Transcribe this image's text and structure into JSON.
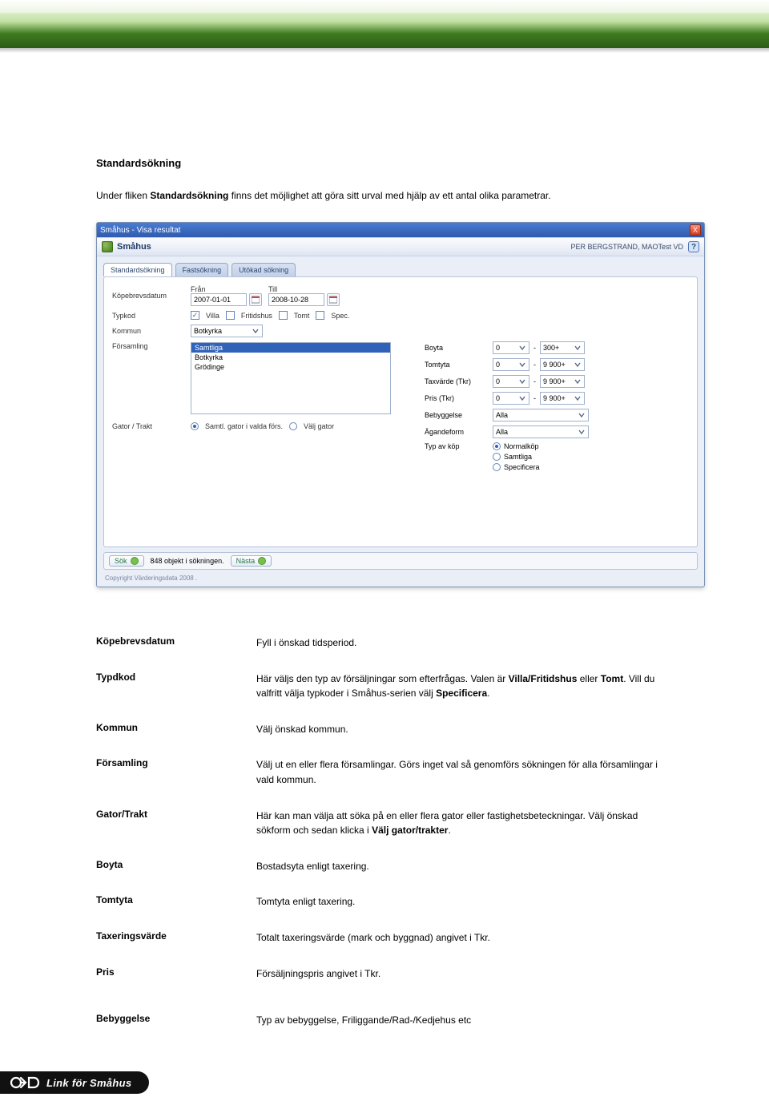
{
  "section": {
    "title": "Standardsökning"
  },
  "intro": {
    "p1a": "Under fliken ",
    "p1b": "Standardsökning",
    "p1c": " finns det möjlighet att göra sitt urval med hjälp av ett antal olika parametrar."
  },
  "window": {
    "title": "Småhus - Visa resultat",
    "close_label": "X",
    "app_name": "Småhus",
    "user_label": "PER BERGSTRAND, MAOTest VD",
    "help_label": "?",
    "tabs": {
      "std": "Standardsökning",
      "fast": "Fastsökning",
      "utok": "Utökad sökning"
    },
    "labels": {
      "kopebrev": "Köpebrevsdatum",
      "fran": "Från",
      "till": "Till",
      "typkod": "Typkod",
      "kommun": "Kommun",
      "forsamling": "Församling",
      "gator": "Gator / Trakt",
      "boyta": "Boyta",
      "tomtyta": "Tomtyta",
      "taxvarde": "Taxvärde (Tkr)",
      "pris": "Pris (Tkr)",
      "bebyggelse": "Bebyggelse",
      "agandeform": "Ägandeform",
      "typavkop": "Typ av köp"
    },
    "values": {
      "fran": "2007-01-01",
      "till": "2008-10-28",
      "chk_villa": "Villa",
      "chk_fritid": "Fritidshus",
      "chk_tomt": "Tomt",
      "chk_spec": "Spec.",
      "kommun_sel": "Botkyrka",
      "fors_list": [
        "Samtliga",
        "Botkyrka",
        "Grödinge"
      ],
      "gator_r1": "Samtl. gator i valda förs.",
      "gator_r2": "Välj gator",
      "range_min": "0",
      "range_to": "-",
      "boyta_max": "300+",
      "tomtyta_max": "9 900+",
      "taxvarde_max": "9 900+",
      "pris_max": "9 900+",
      "beb_sel": "Alla",
      "ag_sel": "Alla",
      "kop_r1": "Normalköp",
      "kop_r2": "Samtliga",
      "kop_r3": "Specificera"
    },
    "footer": {
      "sok": "Sök",
      "status": "848 objekt i sökningen.",
      "nasta": "Nästa",
      "copyright": "Copyright Värderingsdata 2008 ."
    }
  },
  "defs": [
    {
      "term": "Köpebrevsdatum",
      "desc": "Fyll i önskad tidsperiod."
    },
    {
      "term": "Typdkod",
      "desc_html": "Här väljs den typ av försäljningar som efterfrågas. Valen är <b>Villa/Fritidshus</b> eller <b>Tomt</b>. Vill du valfritt välja typkoder i Småhus-serien välj <b>Specificera</b>."
    },
    {
      "term": "Kommun",
      "desc": "Välj önskad kommun."
    },
    {
      "term": "Församling",
      "desc": "Välj ut en eller flera församlingar. Görs inget val så genomförs sökningen för alla församlingar i vald kommun."
    },
    {
      "term": "Gator/Trakt",
      "desc_html": "Här kan man välja att söka på en eller flera gator eller fastighetsbeteckningar. Välj önskad sökform och sedan klicka i <b>Välj gator/trakter</b>."
    },
    {
      "term": "Boyta",
      "desc": "Bostadsyta enligt taxering."
    },
    {
      "term": "Tomtyta",
      "desc": "Tomtyta enligt taxering."
    },
    {
      "term": "Taxeringsvärde",
      "desc": "Totalt taxeringsvärde (mark och byggnad) angivet i Tkr."
    },
    {
      "term": "Pris",
      "desc": "Försäljningspris angivet i Tkr."
    },
    {
      "term": "Bebyggelse",
      "desc": "Typ av bebyggelse, Friliggande/Rad-/Kedjehus etc"
    }
  ],
  "footer": {
    "brand": "Link för Småhus"
  }
}
